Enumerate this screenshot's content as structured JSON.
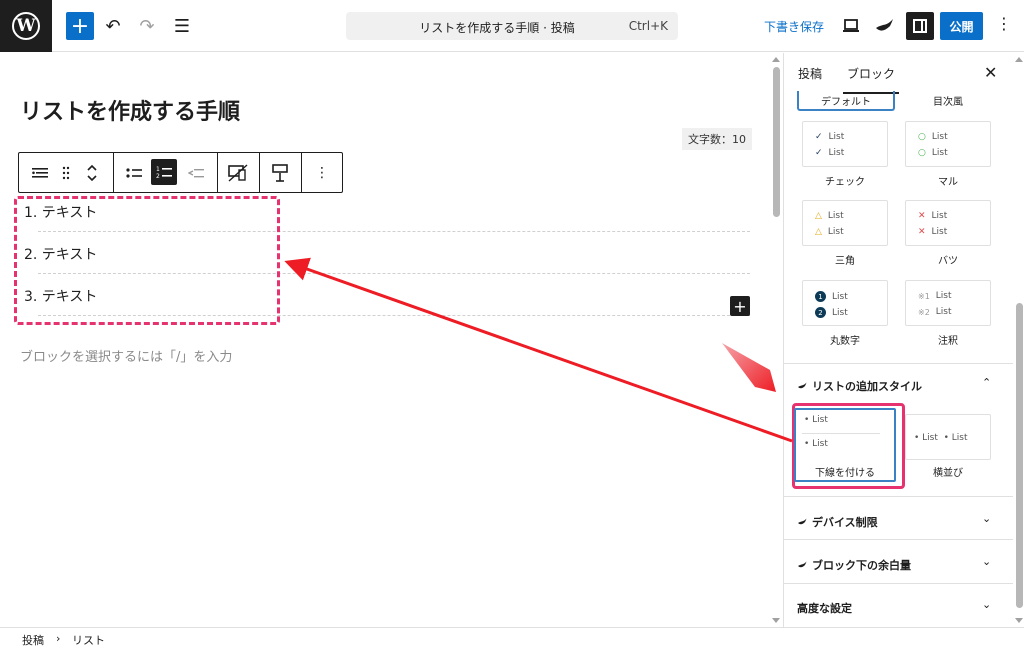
{
  "topbar": {
    "logo": "W",
    "undo_icon": "↶",
    "redo_icon": "↷",
    "list_view_icon": "☰",
    "add_icon": "+",
    "document_title": "リストを作成する手順 · 投稿",
    "shortcut": "Ctrl+K",
    "save_draft": "下書き保存",
    "publish": "公開",
    "more_icon": "⋮"
  },
  "editor": {
    "post_title": "リストを作成する手順",
    "word_count": "文字数：10",
    "list_items": [
      "1. テキスト",
      "2. テキスト",
      "3. テキスト"
    ],
    "placeholder": "ブロックを選択するには「/」を入力",
    "inserter_icon": "+"
  },
  "sidebar": {
    "tabs": [
      "投稿",
      "ブロック"
    ],
    "close_icon": "✕",
    "default_label": "デフォルト",
    "mokuji_label": "目次風",
    "styles": [
      {
        "label": "チェック",
        "marker": "✓",
        "marker_color": "#1e3a5f",
        "lines": [
          "List",
          "List"
        ]
      },
      {
        "label": "マル",
        "marker": "○",
        "marker_color": "#4caf50",
        "lines": [
          "List",
          "List"
        ]
      },
      {
        "label": "三角",
        "marker": "△",
        "marker_color": "#e6a817",
        "lines": [
          "List",
          "List"
        ]
      },
      {
        "label": "バツ",
        "marker": "✕",
        "marker_color": "#e04b4b",
        "lines": [
          "List",
          "List"
        ]
      },
      {
        "label": "丸数字",
        "marker": "●",
        "marker_color": "#0d3b57",
        "markers": [
          "1",
          "2"
        ],
        "lines": [
          "List",
          "List"
        ]
      },
      {
        "label": "注釈",
        "marker": "※",
        "marker_color": "#999999",
        "markers": [
          "※1",
          "※2"
        ],
        "lines": [
          "List",
          "List"
        ]
      }
    ],
    "additional_styles_title": "リストの追加スタイル",
    "underline_style": {
      "label": "下線を付ける",
      "lines": [
        "List",
        "List"
      ]
    },
    "horizontal_style": {
      "label": "横並び",
      "text": "• List  • List"
    },
    "device_title": "デバイス制限",
    "margin_title": "ブロック下の余白量",
    "advanced_title": "高度な設定"
  },
  "footer": {
    "crumb_post": "投稿",
    "crumb_sep": "›",
    "crumb_list": "リスト"
  },
  "colors": {
    "accent": "#0a6fc9",
    "highlight": "#e6336f",
    "arrow": "#ee1c24"
  }
}
